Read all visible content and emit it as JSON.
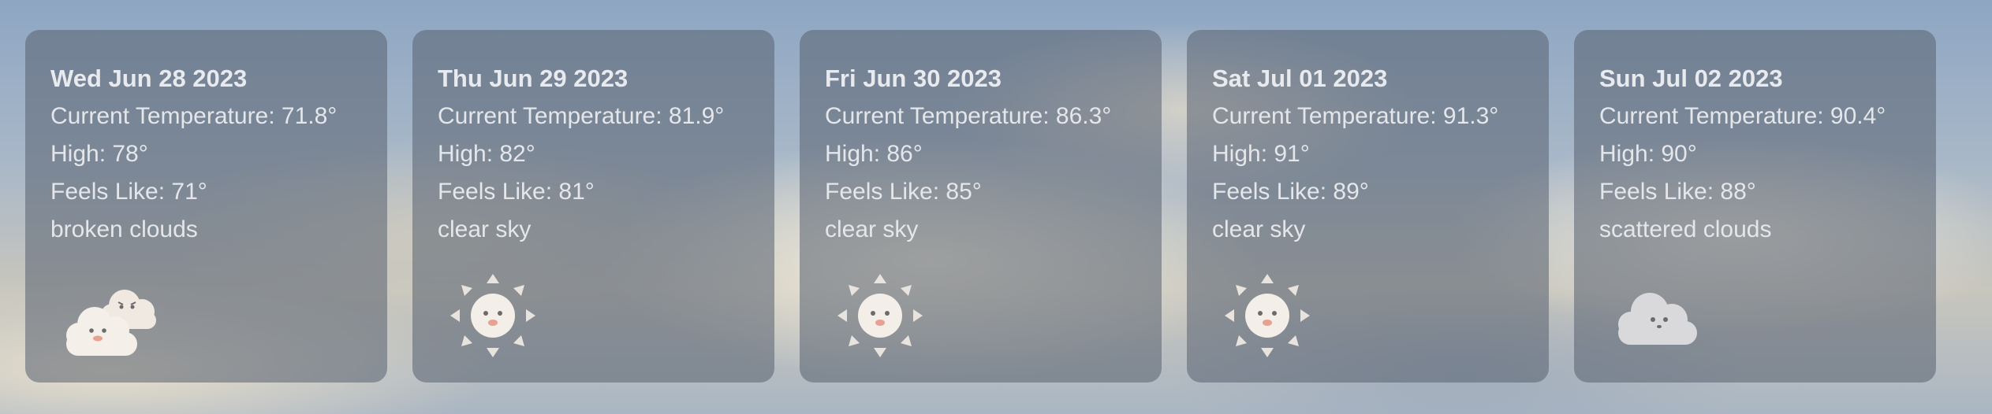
{
  "forecast": [
    {
      "date": "Wed Jun 28 2023",
      "current_temperature": "Current Temperature: 71.8°",
      "high": "High: 78°",
      "feels_like": "Feels Like: 71°",
      "description": "broken clouds",
      "icon": "broken-clouds-icon"
    },
    {
      "date": "Thu Jun 29 2023",
      "current_temperature": "Current Temperature: 81.9°",
      "high": "High: 82°",
      "feels_like": "Feels Like: 81°",
      "description": "clear sky",
      "icon": "sun-icon"
    },
    {
      "date": "Fri Jun 30 2023",
      "current_temperature": "Current Temperature: 86.3°",
      "high": "High: 86°",
      "feels_like": "Feels Like: 85°",
      "description": "clear sky",
      "icon": "sun-icon"
    },
    {
      "date": "Sat Jul 01 2023",
      "current_temperature": "Current Temperature: 91.3°",
      "high": "High: 91°",
      "feels_like": "Feels Like: 89°",
      "description": "clear sky",
      "icon": "sun-icon"
    },
    {
      "date": "Sun Jul 02 2023",
      "current_temperature": "Current Temperature: 90.4°",
      "high": "High: 90°",
      "feels_like": "Feels Like: 88°",
      "description": "scattered clouds",
      "icon": "scattered-clouds-icon"
    }
  ]
}
